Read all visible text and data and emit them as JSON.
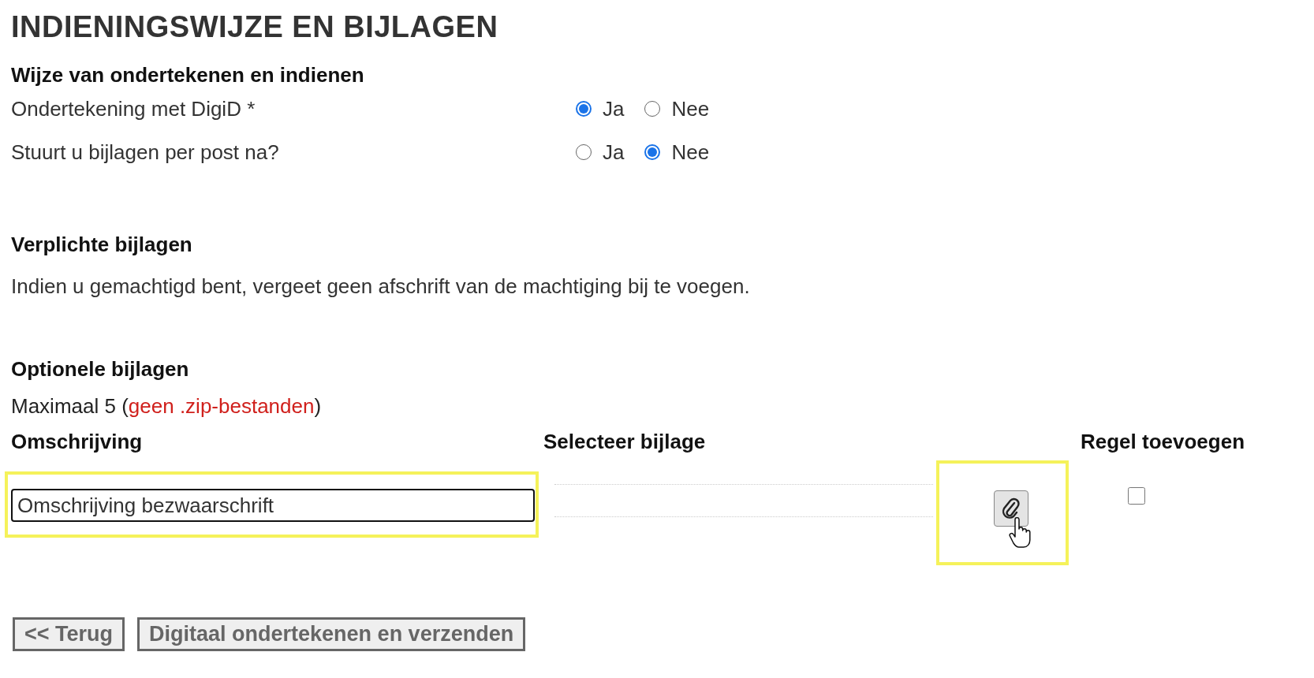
{
  "section_title": "INDIENINGSWIJZE EN BIJLAGEN",
  "signing": {
    "heading": "Wijze van ondertekenen en indienen",
    "questions": [
      {
        "label": "Ondertekening met DigiD *",
        "options": [
          {
            "label": "Ja",
            "selected": true
          },
          {
            "label": "Nee",
            "selected": false
          }
        ]
      },
      {
        "label": "Stuurt u bijlagen per post na?",
        "options": [
          {
            "label": "Ja",
            "selected": false
          },
          {
            "label": "Nee",
            "selected": true
          }
        ]
      }
    ]
  },
  "required": {
    "heading": "Verplichte bijlagen",
    "text": "Indien u gemachtigd bent, vergeet geen afschrift van de machtiging bij te voegen."
  },
  "optional": {
    "heading": "Optionele bijlagen",
    "limit": {
      "prefix": "Maximaal 5 (",
      "warning": "geen .zip-bestanden",
      "suffix": ")"
    },
    "columns": [
      "Omschrijving",
      "Selecteer bijlage",
      "Regel toevoegen"
    ],
    "rows": [
      {
        "description": "Omschrijving bezwaarschrift",
        "description_highlighted": true,
        "attach_highlighted": true,
        "add_line": false
      }
    ]
  },
  "buttons": [
    {
      "label": "<< Terug"
    },
    {
      "label": "Digitaal ondertekenen en verzenden"
    }
  ]
}
